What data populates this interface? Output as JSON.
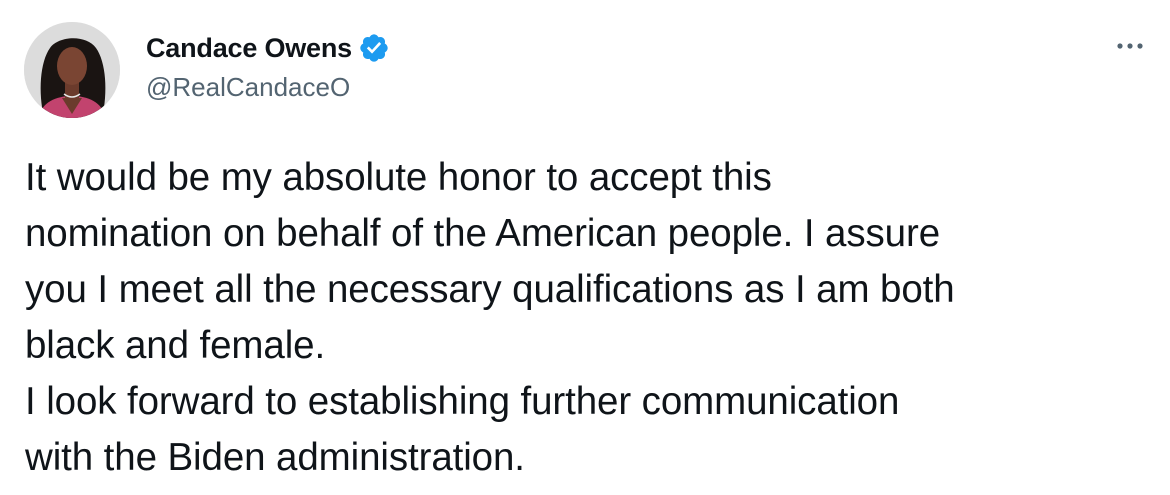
{
  "author": {
    "display_name": "Candace Owens",
    "handle": "@RealCandaceO",
    "verified": true,
    "avatar_icon": "profile-photo"
  },
  "menu": {
    "icon": "more-horizontal-icon"
  },
  "tweet": {
    "text": "It would be my absolute honor to accept this\nnomination on behalf of the American people. I assure\nyou I meet all the necessary qualifications as I am both\nblack and female.\nI look forward to establishing further communication\nwith the Biden administration."
  },
  "colors": {
    "verified_blue": "#1d9bf0",
    "secondary_text": "#536471",
    "primary_text": "#0f1419"
  }
}
